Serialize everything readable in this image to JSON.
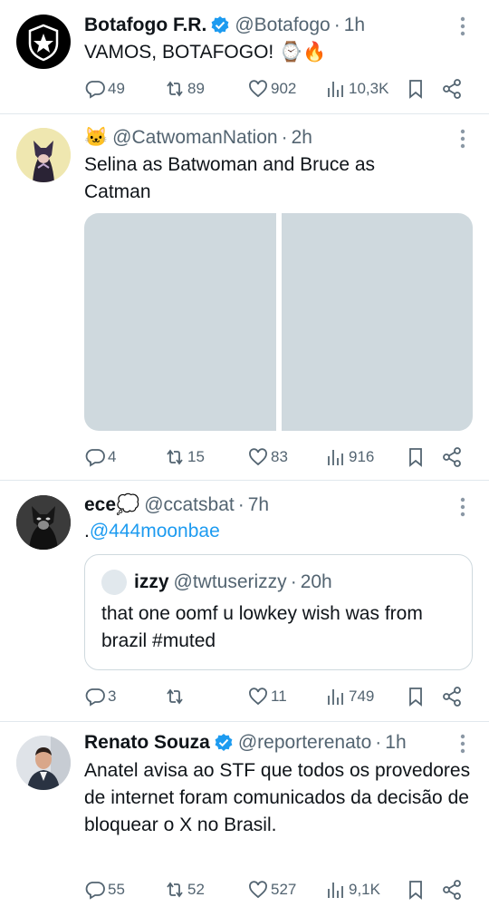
{
  "tweets": [
    {
      "name": "Botafogo F.R.",
      "handle": "@Botafogo",
      "time": "1h",
      "text": "VAMOS, BOTAFOGO! ⌚🔥",
      "replies": "49",
      "retweets": "89",
      "likes": "902",
      "views": "10,3K",
      "verified": true,
      "avatar_icon": "botafogo-star-shield"
    },
    {
      "name": "🐱",
      "handle": "@CatwomanNation",
      "time": "2h",
      "text": "Selina as Batwoman and Bruce as Catman",
      "replies": "4",
      "retweets": "15",
      "likes": "83",
      "views": "916",
      "avatar_icon": "catwoman-avatar"
    },
    {
      "name": "ece💭",
      "handle": "@ccatsbat",
      "time": "7h",
      "text_prefix": ".",
      "mention": "@444moonbae",
      "quote": {
        "name": "izzy",
        "handle": "@twtuserizzy",
        "time": "20h",
        "text": "that one oomf u lowkey wish was from brazil #muted"
      },
      "replies": "3",
      "retweets": "",
      "likes": "11",
      "views": "749",
      "avatar_icon": "catwoman-mask-avatar"
    },
    {
      "name": "Renato Souza",
      "handle": "@reporterenato",
      "time": "1h",
      "text": "Anatel avisa ao STF que todos os provedores de internet foram comunicados da decisão de bloquear o X no Brasil.",
      "replies": "55",
      "retweets": "52",
      "likes": "527",
      "views": "9,1K",
      "verified": true,
      "avatar_icon": "person-photo-avatar"
    }
  ],
  "separator": "·",
  "colors": {
    "accent": "#1d9bf0",
    "muted": "#536471",
    "text": "#0f1419",
    "media": "#cfd9de"
  }
}
